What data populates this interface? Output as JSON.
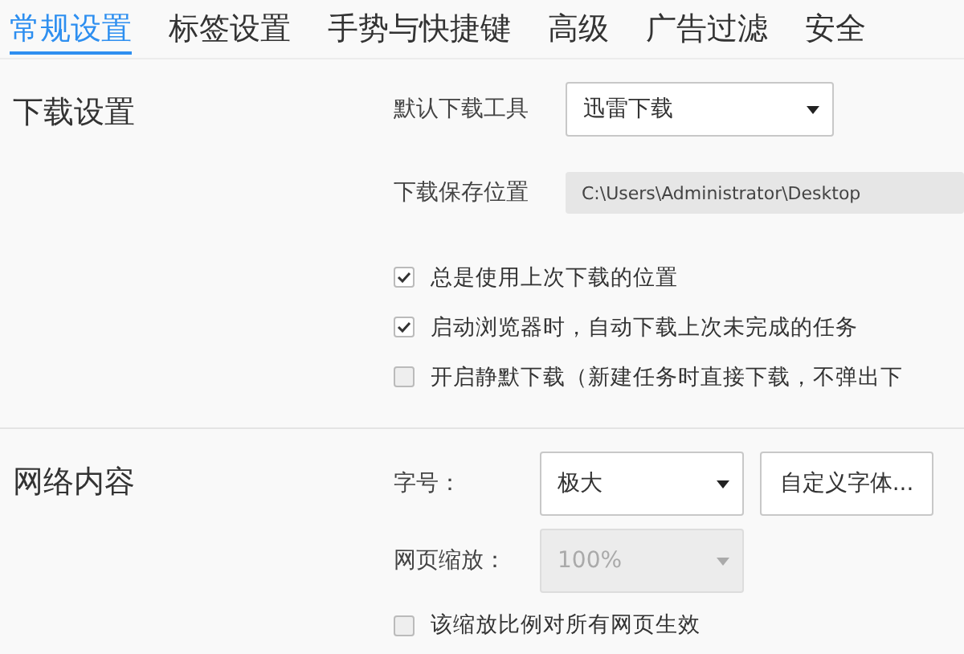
{
  "tabs": [
    {
      "label": "常规设置",
      "selected": true
    },
    {
      "label": "标签设置",
      "selected": false
    },
    {
      "label": "手势与快捷键",
      "selected": false
    },
    {
      "label": "高级",
      "selected": false
    },
    {
      "label": "广告过滤",
      "selected": false
    },
    {
      "label": "安全",
      "selected": false
    }
  ],
  "sections": [
    {
      "title": "下载设置",
      "rows": [
        {
          "kind": "dropdown",
          "label": "默认下载工具",
          "value": "迅雷下载",
          "disabled": false
        },
        {
          "kind": "path",
          "label": "下载保存位置",
          "value": "C:\\Users\\Administrator\\Desktop"
        },
        {
          "kind": "checkbox",
          "label": "总是使用上次下载的位置",
          "checked": true
        },
        {
          "kind": "checkbox",
          "label": "启动浏览器时，自动下载上次未完成的任务",
          "checked": true
        },
        {
          "kind": "checkbox",
          "label": "开启静默下载（新建任务时直接下载，不弹出下",
          "checked": false
        }
      ]
    },
    {
      "title": "网络内容",
      "rows": [
        {
          "kind": "dropdown",
          "label": "字号：",
          "value": "极大",
          "disabled": false,
          "button": "自定义字体..."
        },
        {
          "kind": "dropdown",
          "label": "网页缩放：",
          "value": "100%",
          "disabled": true
        },
        {
          "kind": "checkbox",
          "label": "该缩放比例对所有网页生效",
          "checked": false
        }
      ]
    }
  ]
}
